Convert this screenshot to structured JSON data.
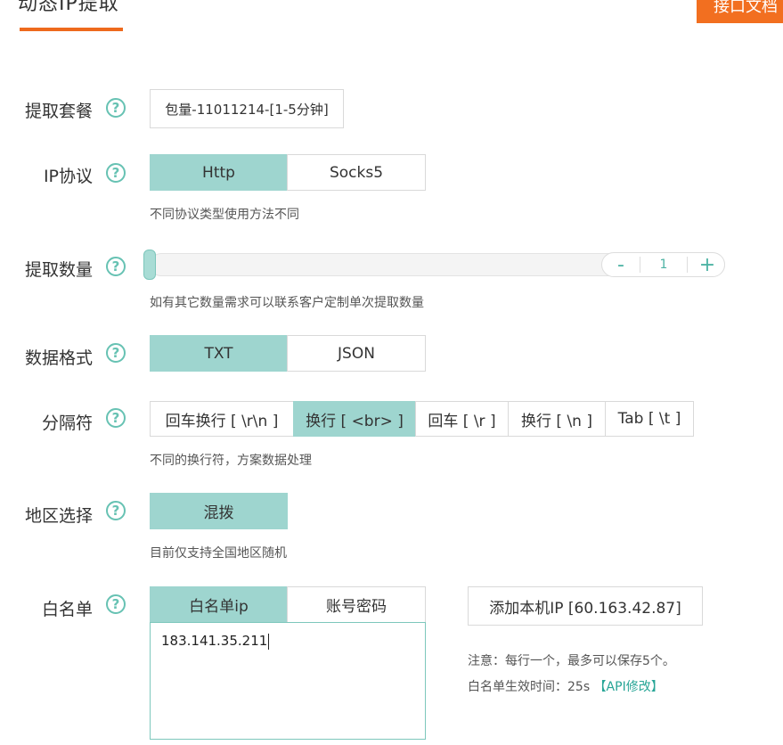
{
  "header": {
    "title": "动态IP提取",
    "doc_button": "接口文档"
  },
  "rows": {
    "plan": {
      "label": "提取套餐",
      "help": "?",
      "value": "包量-11011214-[1-5分钟]"
    },
    "protocol": {
      "label": "IP协议",
      "help": "?",
      "options": [
        "Http",
        "Socks5"
      ],
      "selected": "Http",
      "hint": "不同协议类型使用方法不同"
    },
    "count": {
      "label": "提取数量",
      "help": "?",
      "minus": "-",
      "value": "1",
      "plus": "+",
      "slider_fraction": 0,
      "hint": "如有其它数量需求可以联系客户定制单次提取数量"
    },
    "format": {
      "label": "数据格式",
      "help": "?",
      "options": [
        "TXT",
        "JSON"
      ],
      "selected": "TXT"
    },
    "separator": {
      "label": "分隔符",
      "help": "?",
      "options": [
        "回车换行 [ \\r\\n ]",
        "换行 [ <br> ]",
        "回车 [ \\r ]",
        "换行 [ \\n ]",
        "Tab [ \\t ]"
      ],
      "selected": "换行 [ <br> ]",
      "hint": "不同的换行符，方案数据处理"
    },
    "region": {
      "label": "地区选择",
      "help": "?",
      "options": [
        "混拨"
      ],
      "selected": "混拨",
      "hint": "目前仅支持全国地区随机"
    },
    "whitelist": {
      "label": "白名单",
      "help": "?",
      "tabs": [
        "白名单ip",
        "账号密码"
      ],
      "selected": "白名单ip",
      "textarea_value": "183.141.35.211",
      "add_button": "添加本机IP [60.163.42.87]",
      "note1": "注意：每行一个，最多可以保存5个。",
      "note2_prefix": "白名单生效时间：25s ",
      "note2_link": "【API修改】"
    }
  },
  "colors": {
    "accent": "#f26f20",
    "selected": "#9ed5cf",
    "teal": "#4db3a4"
  }
}
